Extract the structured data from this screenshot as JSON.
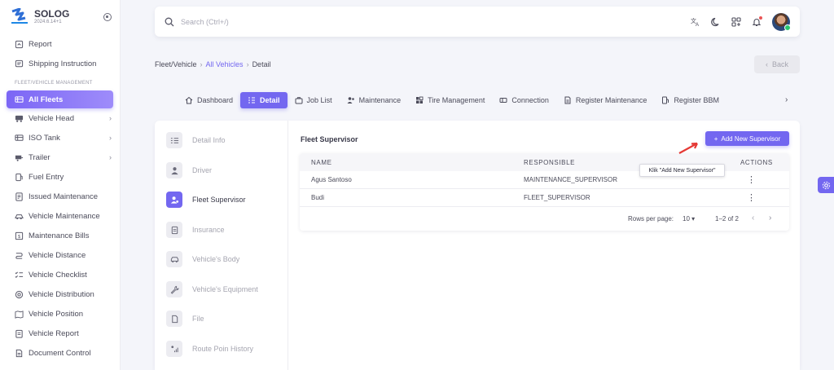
{
  "brand": {
    "name": "SOLOG",
    "version": "2024.6.14+1"
  },
  "sidebar": {
    "items_top": [
      {
        "label": "Report",
        "icon": "report-icon"
      },
      {
        "label": "Shipping Instruction",
        "icon": "shipping-instruction-icon"
      }
    ],
    "section": "FLEET/VEHICLE MANAGEMENT",
    "items": [
      {
        "label": "All Fleets",
        "icon": "fleet-icon",
        "active": true
      },
      {
        "label": "Vehicle Head",
        "icon": "truck-icon",
        "chevron": true
      },
      {
        "label": "ISO Tank",
        "icon": "tank-icon",
        "chevron": true
      },
      {
        "label": "Trailer",
        "icon": "trailer-icon",
        "chevron": true
      },
      {
        "label": "Fuel Entry",
        "icon": "fuel-icon"
      },
      {
        "label": "Issued Maintenance",
        "icon": "issued-maintenance-icon"
      },
      {
        "label": "Vehicle Maintenance",
        "icon": "vehicle-maintenance-icon"
      },
      {
        "label": "Maintenance Bills",
        "icon": "bills-icon"
      },
      {
        "label": "Vehicle Distance",
        "icon": "distance-icon"
      },
      {
        "label": "Vehicle Checklist",
        "icon": "checklist-icon"
      },
      {
        "label": "Vehicle Distribution",
        "icon": "distribution-icon"
      },
      {
        "label": "Vehicle Position",
        "icon": "position-icon"
      },
      {
        "label": "Vehicle Report",
        "icon": "vehicle-report-icon"
      },
      {
        "label": "Document Control",
        "icon": "document-icon"
      }
    ]
  },
  "search": {
    "placeholder": "Search (Ctrl+/)"
  },
  "breadcrumb": {
    "root": "Fleet/Vehicle",
    "link": "All Vehicles",
    "current": "Detail",
    "sep": "›"
  },
  "back": {
    "label": "Back"
  },
  "tabs": [
    {
      "label": "Dashboard",
      "icon": "home-icon"
    },
    {
      "label": "Detail",
      "icon": "detail-icon",
      "active": true
    },
    {
      "label": "Job List",
      "icon": "briefcase-icon"
    },
    {
      "label": "Maintenance",
      "icon": "users-icon"
    },
    {
      "label": "Tire Management",
      "icon": "tire-icon"
    },
    {
      "label": "Connection",
      "icon": "connection-icon"
    },
    {
      "label": "Register Maintenance",
      "icon": "register-icon"
    },
    {
      "label": "Register BBM",
      "icon": "fuel-pump-icon"
    }
  ],
  "vnav": [
    {
      "label": "Detail Info"
    },
    {
      "label": "Driver"
    },
    {
      "label": "Fleet Supervisor",
      "active": true
    },
    {
      "label": "Insurance"
    },
    {
      "label": "Vehicle's Body"
    },
    {
      "label": "Vehicle's Equipment"
    },
    {
      "label": "File"
    },
    {
      "label": "Route Poin History"
    }
  ],
  "panel": {
    "title": "Fleet Supervisor",
    "add_button": "Add New Supervisor",
    "columns": {
      "name": "NAME",
      "responsible": "RESPONSIBLE",
      "actions": "ACTIONS"
    },
    "rows": [
      {
        "name": "Agus Santoso",
        "responsible": "MAINTENANCE_SUPERVISOR"
      },
      {
        "name": "Budi",
        "responsible": "FLEET_SUPERVISOR"
      }
    ],
    "pagination": {
      "rows_per_page_label": "Rows per page:",
      "rows_per_page": "10",
      "range": "1–2 of 2"
    }
  },
  "tooltip": {
    "text": "Klik \"Add New Supervisor\""
  },
  "colors": {
    "accent": "#7367f0",
    "arrow": "#e53935"
  }
}
